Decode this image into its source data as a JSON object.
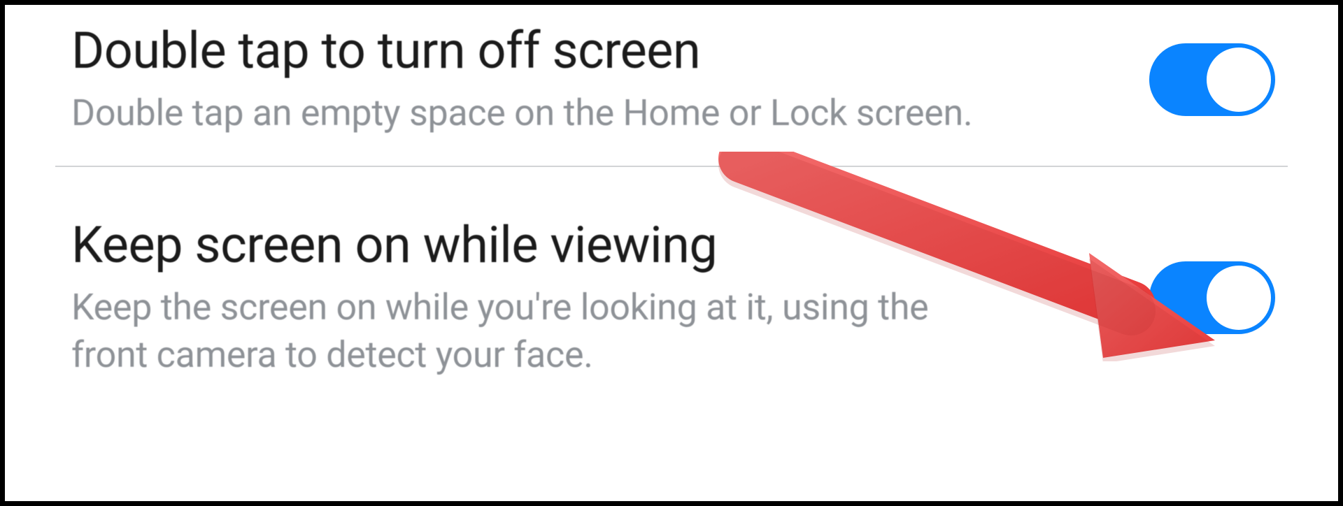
{
  "settings": [
    {
      "id": "double-tap-off",
      "title": "Double tap to turn off screen",
      "description": "Double tap an empty space on the Home or Lock screen.",
      "enabled": true
    },
    {
      "id": "keep-screen-on",
      "title": "Keep screen on while viewing",
      "description": "Keep the screen on while you're looking at it, using the front camera to detect your face.",
      "enabled": true
    }
  ],
  "annotation": {
    "type": "arrow",
    "target": "keep-screen-on-toggle",
    "color": "#f04a4a"
  },
  "colors": {
    "accent": "#0a84ff",
    "title": "#1b1b1b",
    "description": "#8e9297",
    "arrow": "#f04a4a"
  }
}
